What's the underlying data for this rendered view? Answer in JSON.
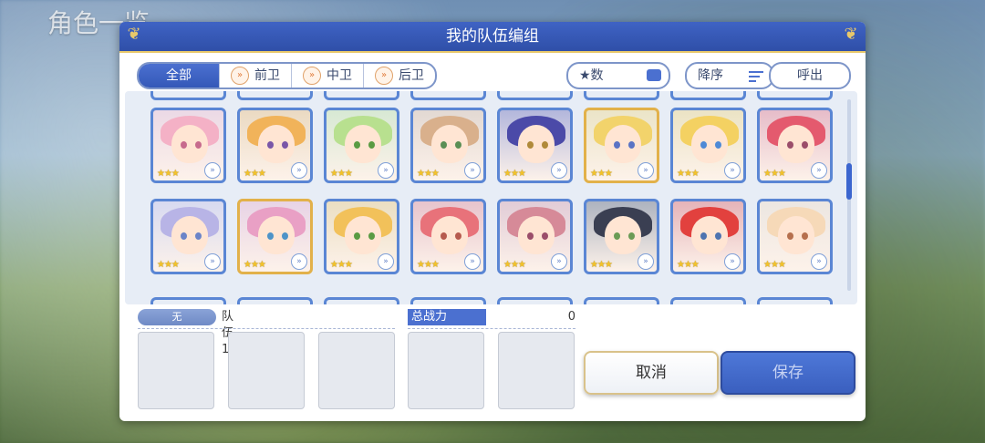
{
  "background": {
    "title": "角色一览"
  },
  "dialog": {
    "title": "我的队伍编组",
    "tabs": [
      {
        "label": "全部",
        "icon": ""
      },
      {
        "label": "前卫",
        "icon": "chevron-right-icon"
      },
      {
        "label": "中卫",
        "icon": "chevron-right-icon"
      },
      {
        "label": "后卫",
        "icon": "chevron-right-icon"
      }
    ],
    "filter_stars_label": "★数",
    "sort_label": "降序",
    "call_label": "呼出"
  },
  "characters": {
    "row1": [
      {
        "gold": false,
        "hair": "#f4b1c6",
        "eye": "#c76b8d",
        "stars": "★★★"
      },
      {
        "gold": false,
        "hair": "#f1b35a",
        "eye": "#7a57a8",
        "stars": "★★★"
      },
      {
        "gold": false,
        "hair": "#b8e08f",
        "eye": "#5a9b43",
        "stars": "★★★"
      },
      {
        "gold": false,
        "hair": "#d9b08c",
        "eye": "#5a8f55",
        "stars": "★★★"
      },
      {
        "gold": false,
        "hair": "#4b4aa8",
        "eye": "#b08a3a",
        "stars": "★★★"
      },
      {
        "gold": true,
        "hair": "#f2d36b",
        "eye": "#5a73c4",
        "stars": "★★★"
      },
      {
        "gold": false,
        "hair": "#f4d162",
        "eye": "#4e8ad6",
        "stars": "★★★"
      },
      {
        "gold": false,
        "hair": "#e45a6e",
        "eye": "#9b4e6a",
        "stars": "★★★"
      }
    ],
    "row2": [
      {
        "gold": false,
        "hair": "#b8b4e6",
        "eye": "#6b84c8",
        "stars": "★★★"
      },
      {
        "gold": true,
        "hair": "#e9a0c5",
        "eye": "#4e93c8",
        "stars": "★★★"
      },
      {
        "gold": false,
        "hair": "#f2c15a",
        "eye": "#5a9b43",
        "stars": "★★★"
      },
      {
        "gold": false,
        "hair": "#e8727a",
        "eye": "#b65a4e",
        "stars": "★★★"
      },
      {
        "gold": false,
        "hair": "#d68a98",
        "eye": "#9b4e6a",
        "stars": "★★★"
      },
      {
        "gold": false,
        "hair": "#3a3f52",
        "eye": "#6b9b55",
        "stars": "★★★"
      },
      {
        "gold": false,
        "hair": "#e2413e",
        "eye": "#4e73b0",
        "stars": "★★★"
      },
      {
        "gold": false,
        "hair": "#f6d9b8",
        "eye": "#b6704e",
        "stars": "★★★"
      }
    ]
  },
  "team": {
    "position_badge": "无",
    "name": "队伍1",
    "power_label": "总战力",
    "power_value": "0"
  },
  "buttons": {
    "cancel": "取消",
    "save": "保存"
  }
}
